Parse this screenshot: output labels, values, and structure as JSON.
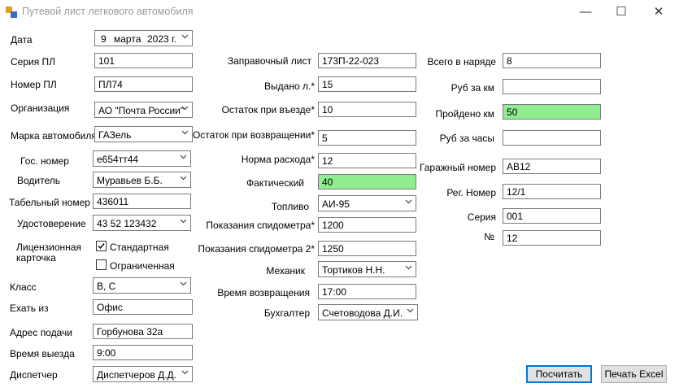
{
  "window": {
    "title": "Путевой лист легкового автомобиля",
    "minimize": "—",
    "maximize": "☐",
    "close": "✕"
  },
  "col1": {
    "date_label": "Дата",
    "date_day": "9",
    "date_month": "марта",
    "date_year": "2023 г.",
    "series_label": "Серия ПЛ",
    "series_value": "101",
    "number_label": "Номер ПЛ",
    "number_value": "ПЛ74",
    "org_label": "Организация",
    "org_value": "АО \"Почта России\"",
    "brand_label": "Марка автомобиля",
    "brand_value": "ГАЗель",
    "plate_label": "Гос. номер",
    "plate_value": "е654тт44",
    "driver_label": "Водитель",
    "driver_value": "Муравьев Б.Б.",
    "tab_label": "Табельный номер",
    "tab_value": "436011",
    "license_label": "Удостоверение",
    "license_value": "43 52 123432",
    "card_label_1": "Лицензионная",
    "card_label_2": "карточка",
    "card_standard": "Стандартная",
    "card_standard_checked": true,
    "card_limited": "Ограниченная",
    "card_limited_checked": false,
    "class_label": "Класс",
    "class_value": "В, С",
    "from_label": "Ехать из",
    "from_value": "Офис",
    "address_label": "Адрес подачи",
    "address_value": "Горбунова 32а",
    "depart_label": "Время выезда",
    "depart_value": "9:00",
    "dispatcher_label": "Диспетчер",
    "dispatcher_value": "Диспетчеров Д.Д."
  },
  "col2": {
    "fuel_sheet_label": "Заправочный лист",
    "fuel_sheet_value": "173П-22-023",
    "issued_label": "Выдано л.*",
    "issued_value": "15",
    "remain_out_label": "Остаток при въезде*",
    "remain_out_value": "10",
    "remain_back_label": "Остаток при возвращении*",
    "remain_back_value": "5",
    "norm_label": "Норма расхода*",
    "norm_value": "12",
    "actual_label": "Фактический",
    "actual_value": "40",
    "fuel_label": "Топливо",
    "fuel_value": "АИ-95",
    "odo_label": "Показания спидометра*",
    "odo_value": "1200",
    "odo2_label": "Показания спидометра 2*",
    "odo2_value": "1250",
    "mechanic_label": "Механик",
    "mechanic_value": "Тортиков Н.Н.",
    "return_label": "Время возвращения",
    "return_value": "17:00",
    "accountant_label": "Бухгалтер",
    "accountant_value": "Счетоводова Д.И."
  },
  "col3": {
    "total_label": "Всего в наряде",
    "total_value": "8",
    "rub_km_label": "Руб за км",
    "rub_km_value": "",
    "passed_label": "Пройдено км",
    "passed_value": "50",
    "rub_hour_label": "Руб за часы",
    "rub_hour_value": "",
    "garage_label": "Гаражный номер",
    "garage_value": "АВ12",
    "reg_label": "Рег. Номер",
    "reg_value": "12/1",
    "series_label": "Серия",
    "series_value": "001",
    "num_label": "№",
    "num_value": "12"
  },
  "buttons": {
    "calc": "Посчитать",
    "excel": "Печать Excel"
  },
  "colors": {
    "highlight_green": "#90ee90",
    "default_button_border": "#0078d7"
  }
}
